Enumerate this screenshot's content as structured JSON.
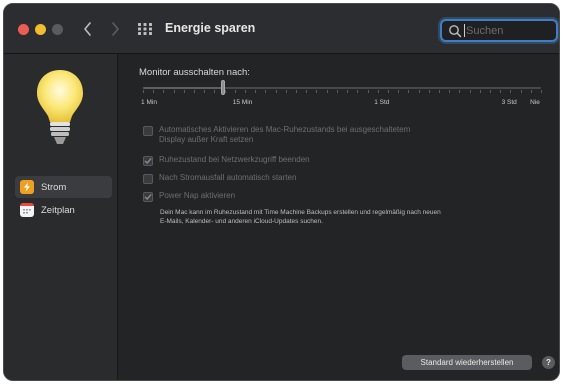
{
  "window": {
    "title": "Energie sparen",
    "search": {
      "placeholder": "Suchen",
      "value": ""
    },
    "traffic_colors": {
      "close": "#ee5d55",
      "minimize": "#f1bc2f",
      "zoom": "#5a5b5d"
    }
  },
  "sidebar": {
    "items": [
      {
        "label": "Strom",
        "icon": "lightning-bolt-icon",
        "selected": true,
        "icon_color": "#f0a020"
      },
      {
        "label": "Zeitplan",
        "icon": "calendar-icon",
        "selected": false,
        "icon_color": "#e84b3c"
      }
    ]
  },
  "main": {
    "monitor_label": "Monitor ausschalten nach:",
    "slider": {
      "value_fraction": 0.2,
      "ticks": [
        "1 Min",
        "15 Min",
        "1 Std",
        "3 Std",
        "Nie"
      ]
    },
    "options": [
      {
        "lines": [
          "Automatisches Aktivieren des Mac-Ruhezustands bei ausgeschaltetem",
          "Display außer Kraft setzen"
        ],
        "checked": false,
        "enabled": false
      },
      {
        "lines": [
          "Ruhezustand bei Netzwerkzugriff beenden"
        ],
        "checked": true,
        "enabled": false
      },
      {
        "lines": [
          "Nach Stromausfall automatisch starten"
        ],
        "checked": false,
        "enabled": false
      },
      {
        "lines": [
          "Power Nap aktivieren"
        ],
        "checked": true,
        "enabled": false
      }
    ],
    "powernap_description": [
      "Dein Mac kann im Ruhezustand mit Time Machine Backups erstellen und regelmäßig nach neuen",
      "E-Mails, Kalender- und anderen iCloud-Updates suchen."
    ],
    "restore_button": "Standard wiederherstellen",
    "help_button": "?"
  }
}
